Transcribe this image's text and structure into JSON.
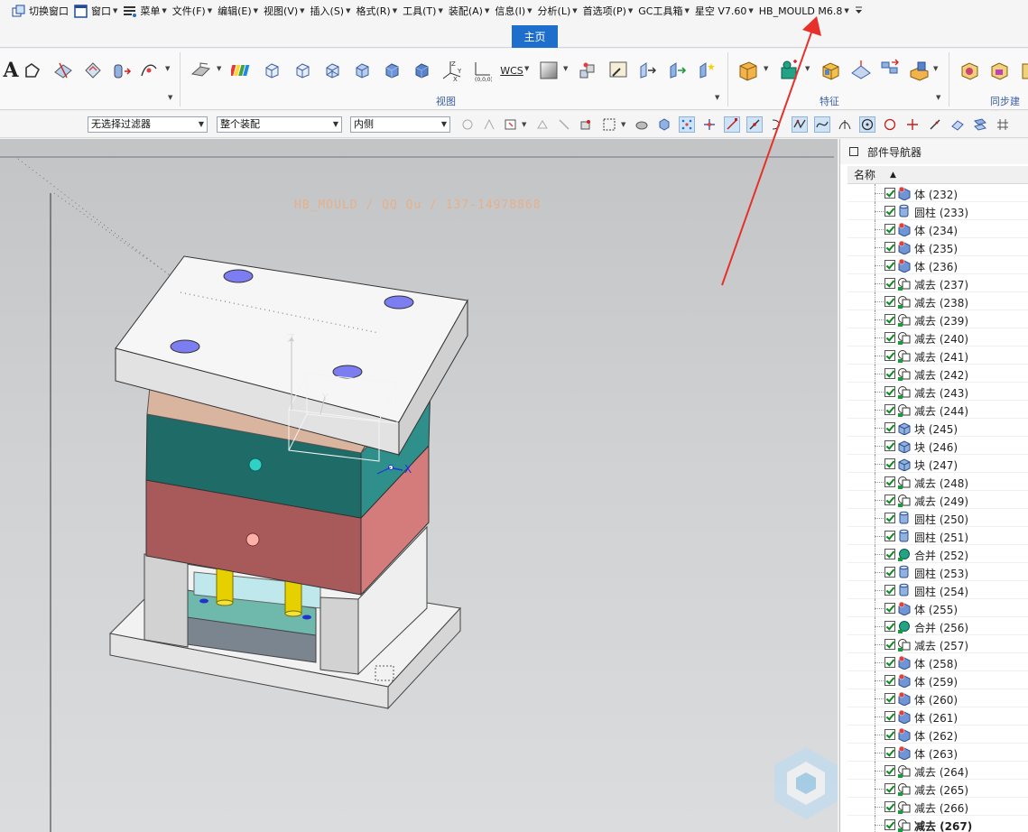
{
  "menubar": {
    "items": [
      {
        "label": "切换窗口",
        "icon": "switch-window-icon",
        "arrow": false
      },
      {
        "label": "窗口",
        "icon": "window-icon",
        "arrow": true
      },
      {
        "label": "菜单",
        "icon": "menu-icon",
        "arrow": true
      },
      {
        "label": "文件(F)",
        "arrow": true
      },
      {
        "label": "编辑(E)",
        "arrow": true
      },
      {
        "label": "视图(V)",
        "arrow": true
      },
      {
        "label": "插入(S)",
        "arrow": true
      },
      {
        "label": "格式(R)",
        "arrow": true
      },
      {
        "label": "工具(T)",
        "arrow": true
      },
      {
        "label": "装配(A)",
        "arrow": true
      },
      {
        "label": "信息(I)",
        "arrow": true
      },
      {
        "label": "分析(L)",
        "arrow": true
      },
      {
        "label": "首选项(P)",
        "arrow": true
      },
      {
        "label": "GC工具箱",
        "arrow": true
      },
      {
        "label": "星空 V7.60",
        "arrow": true
      },
      {
        "label": "HB_MOULD M6.8",
        "arrow": true
      }
    ],
    "overflow_icon": "overflow-chevron-icon"
  },
  "tabs": {
    "active": "主页"
  },
  "ribbon": {
    "groups": {
      "view": "视图",
      "feature": "特征",
      "sync": "同步建模"
    },
    "wcs_label": "WCS"
  },
  "filterbar": {
    "type_filter": "无选择过滤器",
    "scope_filter": "整个装配",
    "side_filter": "内侧"
  },
  "viewport": {
    "watermark": "HB_MOULD / QQ Qu / 137-14978868",
    "axis_x": "X",
    "axis_y": "Y",
    "axis_z": "Z"
  },
  "navigator": {
    "title": "部件导航器",
    "column_name": "名称",
    "items": [
      {
        "label": "体 (232)",
        "icon": "body-icon"
      },
      {
        "label": "圆柱 (233)",
        "icon": "cylinder-icon"
      },
      {
        "label": "体 (234)",
        "icon": "body-icon"
      },
      {
        "label": "体 (235)",
        "icon": "body-icon"
      },
      {
        "label": "体 (236)",
        "icon": "body-icon"
      },
      {
        "label": "减去 (237)",
        "icon": "subtract-icon"
      },
      {
        "label": "减去 (238)",
        "icon": "subtract-icon"
      },
      {
        "label": "减去 (239)",
        "icon": "subtract-icon"
      },
      {
        "label": "减去 (240)",
        "icon": "subtract-icon"
      },
      {
        "label": "减去 (241)",
        "icon": "subtract-icon"
      },
      {
        "label": "减去 (242)",
        "icon": "subtract-icon"
      },
      {
        "label": "减去 (243)",
        "icon": "subtract-icon"
      },
      {
        "label": "减去 (244)",
        "icon": "subtract-icon"
      },
      {
        "label": "块 (245)",
        "icon": "block-icon"
      },
      {
        "label": "块 (246)",
        "icon": "block-icon"
      },
      {
        "label": "块 (247)",
        "icon": "block-icon"
      },
      {
        "label": "减去 (248)",
        "icon": "subtract-icon"
      },
      {
        "label": "减去 (249)",
        "icon": "subtract-icon"
      },
      {
        "label": "圆柱 (250)",
        "icon": "cylinder-icon"
      },
      {
        "label": "圆柱 (251)",
        "icon": "cylinder-icon"
      },
      {
        "label": "合并 (252)",
        "icon": "unite-icon"
      },
      {
        "label": "圆柱 (253)",
        "icon": "cylinder-icon"
      },
      {
        "label": "圆柱 (254)",
        "icon": "cylinder-icon"
      },
      {
        "label": "体 (255)",
        "icon": "body-icon"
      },
      {
        "label": "合并 (256)",
        "icon": "unite-icon"
      },
      {
        "label": "减去 (257)",
        "icon": "subtract-icon"
      },
      {
        "label": "体 (258)",
        "icon": "body-icon"
      },
      {
        "label": "体 (259)",
        "icon": "body-icon"
      },
      {
        "label": "体 (260)",
        "icon": "body-icon"
      },
      {
        "label": "体 (261)",
        "icon": "body-icon"
      },
      {
        "label": "体 (262)",
        "icon": "body-icon"
      },
      {
        "label": "体 (263)",
        "icon": "body-icon"
      },
      {
        "label": "减去 (264)",
        "icon": "subtract-icon"
      },
      {
        "label": "减去 (265)",
        "icon": "subtract-icon"
      },
      {
        "label": "减去 (266)",
        "icon": "subtract-icon"
      },
      {
        "label": "减去 (267)",
        "icon": "subtract-icon"
      }
    ]
  },
  "colors": {
    "accent": "#1e6fcc",
    "annotation_arrow": "#e8302a",
    "plate_top": "#f4f4f4",
    "a_plate": "#1f6b68",
    "b_plate": "#a85a5a",
    "guide_pin": "#e0d000"
  }
}
